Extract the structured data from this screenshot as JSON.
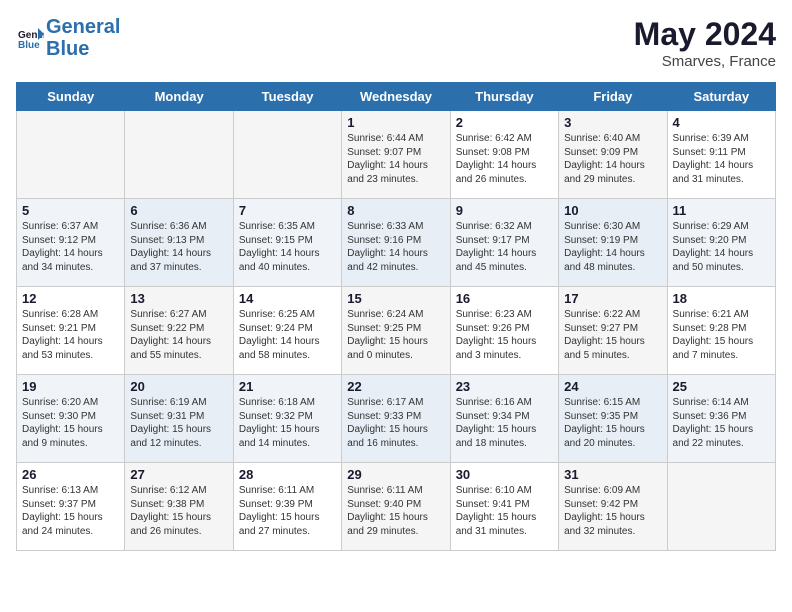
{
  "header": {
    "logo_line1": "General",
    "logo_line2": "Blue",
    "month_year": "May 2024",
    "location": "Smarves, France"
  },
  "days_of_week": [
    "Sunday",
    "Monday",
    "Tuesday",
    "Wednesday",
    "Thursday",
    "Friday",
    "Saturday"
  ],
  "weeks": [
    [
      {
        "day": "",
        "info": ""
      },
      {
        "day": "",
        "info": ""
      },
      {
        "day": "",
        "info": ""
      },
      {
        "day": "1",
        "info": "Sunrise: 6:44 AM\nSunset: 9:07 PM\nDaylight: 14 hours\nand 23 minutes."
      },
      {
        "day": "2",
        "info": "Sunrise: 6:42 AM\nSunset: 9:08 PM\nDaylight: 14 hours\nand 26 minutes."
      },
      {
        "day": "3",
        "info": "Sunrise: 6:40 AM\nSunset: 9:09 PM\nDaylight: 14 hours\nand 29 minutes."
      },
      {
        "day": "4",
        "info": "Sunrise: 6:39 AM\nSunset: 9:11 PM\nDaylight: 14 hours\nand 31 minutes."
      }
    ],
    [
      {
        "day": "5",
        "info": "Sunrise: 6:37 AM\nSunset: 9:12 PM\nDaylight: 14 hours\nand 34 minutes."
      },
      {
        "day": "6",
        "info": "Sunrise: 6:36 AM\nSunset: 9:13 PM\nDaylight: 14 hours\nand 37 minutes."
      },
      {
        "day": "7",
        "info": "Sunrise: 6:35 AM\nSunset: 9:15 PM\nDaylight: 14 hours\nand 40 minutes."
      },
      {
        "day": "8",
        "info": "Sunrise: 6:33 AM\nSunset: 9:16 PM\nDaylight: 14 hours\nand 42 minutes."
      },
      {
        "day": "9",
        "info": "Sunrise: 6:32 AM\nSunset: 9:17 PM\nDaylight: 14 hours\nand 45 minutes."
      },
      {
        "day": "10",
        "info": "Sunrise: 6:30 AM\nSunset: 9:19 PM\nDaylight: 14 hours\nand 48 minutes."
      },
      {
        "day": "11",
        "info": "Sunrise: 6:29 AM\nSunset: 9:20 PM\nDaylight: 14 hours\nand 50 minutes."
      }
    ],
    [
      {
        "day": "12",
        "info": "Sunrise: 6:28 AM\nSunset: 9:21 PM\nDaylight: 14 hours\nand 53 minutes."
      },
      {
        "day": "13",
        "info": "Sunrise: 6:27 AM\nSunset: 9:22 PM\nDaylight: 14 hours\nand 55 minutes."
      },
      {
        "day": "14",
        "info": "Sunrise: 6:25 AM\nSunset: 9:24 PM\nDaylight: 14 hours\nand 58 minutes."
      },
      {
        "day": "15",
        "info": "Sunrise: 6:24 AM\nSunset: 9:25 PM\nDaylight: 15 hours\nand 0 minutes."
      },
      {
        "day": "16",
        "info": "Sunrise: 6:23 AM\nSunset: 9:26 PM\nDaylight: 15 hours\nand 3 minutes."
      },
      {
        "day": "17",
        "info": "Sunrise: 6:22 AM\nSunset: 9:27 PM\nDaylight: 15 hours\nand 5 minutes."
      },
      {
        "day": "18",
        "info": "Sunrise: 6:21 AM\nSunset: 9:28 PM\nDaylight: 15 hours\nand 7 minutes."
      }
    ],
    [
      {
        "day": "19",
        "info": "Sunrise: 6:20 AM\nSunset: 9:30 PM\nDaylight: 15 hours\nand 9 minutes."
      },
      {
        "day": "20",
        "info": "Sunrise: 6:19 AM\nSunset: 9:31 PM\nDaylight: 15 hours\nand 12 minutes."
      },
      {
        "day": "21",
        "info": "Sunrise: 6:18 AM\nSunset: 9:32 PM\nDaylight: 15 hours\nand 14 minutes."
      },
      {
        "day": "22",
        "info": "Sunrise: 6:17 AM\nSunset: 9:33 PM\nDaylight: 15 hours\nand 16 minutes."
      },
      {
        "day": "23",
        "info": "Sunrise: 6:16 AM\nSunset: 9:34 PM\nDaylight: 15 hours\nand 18 minutes."
      },
      {
        "day": "24",
        "info": "Sunrise: 6:15 AM\nSunset: 9:35 PM\nDaylight: 15 hours\nand 20 minutes."
      },
      {
        "day": "25",
        "info": "Sunrise: 6:14 AM\nSunset: 9:36 PM\nDaylight: 15 hours\nand 22 minutes."
      }
    ],
    [
      {
        "day": "26",
        "info": "Sunrise: 6:13 AM\nSunset: 9:37 PM\nDaylight: 15 hours\nand 24 minutes."
      },
      {
        "day": "27",
        "info": "Sunrise: 6:12 AM\nSunset: 9:38 PM\nDaylight: 15 hours\nand 26 minutes."
      },
      {
        "day": "28",
        "info": "Sunrise: 6:11 AM\nSunset: 9:39 PM\nDaylight: 15 hours\nand 27 minutes."
      },
      {
        "day": "29",
        "info": "Sunrise: 6:11 AM\nSunset: 9:40 PM\nDaylight: 15 hours\nand 29 minutes."
      },
      {
        "day": "30",
        "info": "Sunrise: 6:10 AM\nSunset: 9:41 PM\nDaylight: 15 hours\nand 31 minutes."
      },
      {
        "day": "31",
        "info": "Sunrise: 6:09 AM\nSunset: 9:42 PM\nDaylight: 15 hours\nand 32 minutes."
      },
      {
        "day": "",
        "info": ""
      }
    ]
  ]
}
